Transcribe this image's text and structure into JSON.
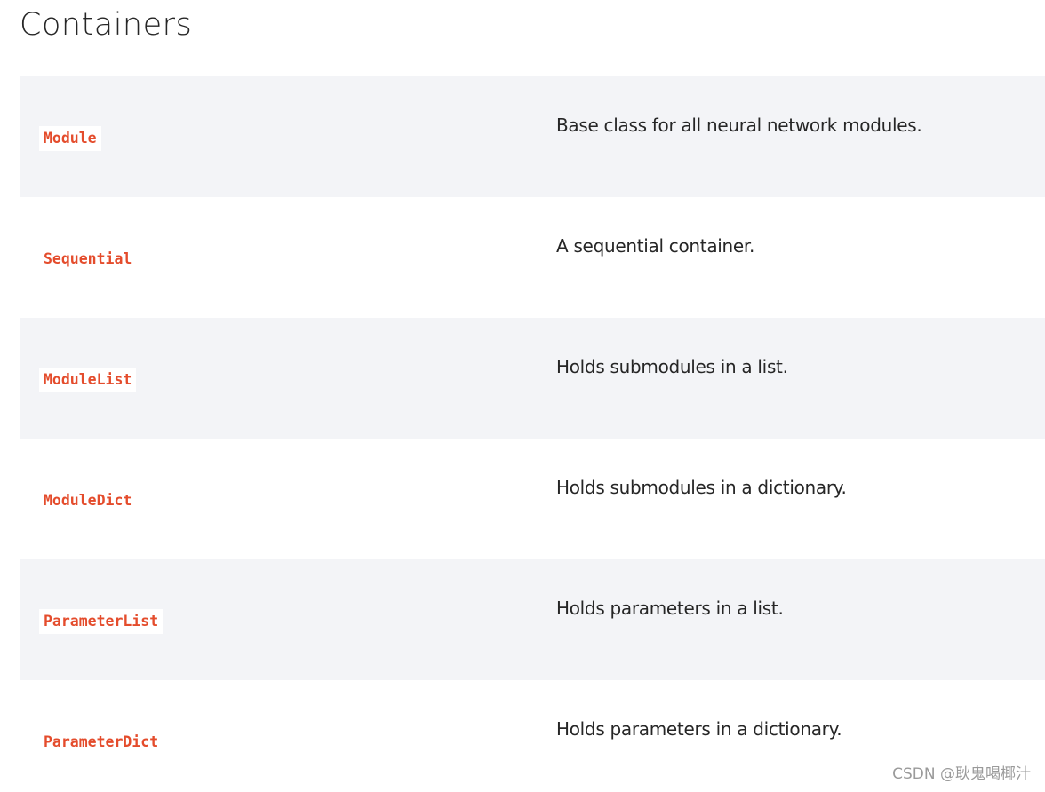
{
  "page": {
    "title": "Containers"
  },
  "table": {
    "rows": [
      {
        "name": "Module",
        "description": "Base class for all neural network modules."
      },
      {
        "name": "Sequential",
        "description": "A sequential container."
      },
      {
        "name": "ModuleList",
        "description": "Holds submodules in a list."
      },
      {
        "name": "ModuleDict",
        "description": "Holds submodules in a dictionary."
      },
      {
        "name": "ParameterList",
        "description": "Holds parameters in a list."
      },
      {
        "name": "ParameterDict",
        "description": "Holds parameters in a dictionary."
      }
    ]
  },
  "watermark": "CSDN @耿鬼喝椰汁",
  "colors": {
    "code_text": "#e44c2c",
    "row_shade": "#f3f4f7",
    "body_text": "#262626",
    "watermark_text": "#9a9a9a"
  }
}
